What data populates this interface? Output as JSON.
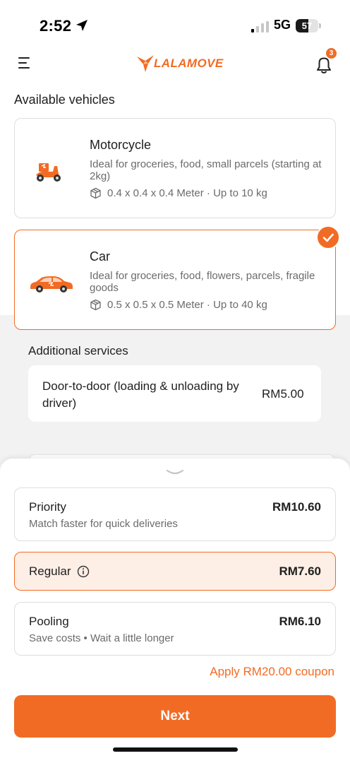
{
  "status_bar": {
    "time": "2:52",
    "network": "5G",
    "battery": "57",
    "battery_level": 0.57,
    "icons": [
      "location-arrow-icon",
      "signal-icon",
      "battery-icon"
    ]
  },
  "header": {
    "logo_text": "LALAMOVE",
    "notification_count": "3",
    "icons": [
      "menu-icon",
      "bell-icon"
    ]
  },
  "vehicles": {
    "title": "Available vehicles",
    "items": [
      {
        "name": "Motorcycle",
        "description": "Ideal for groceries, food, small parcels (starting at 2kg)",
        "dimensions": "0.4 x 0.4 x 0.4 Meter · Up to 10 kg",
        "selected": false
      },
      {
        "name": "Car",
        "description": "Ideal for groceries, food, flowers, parcels, fragile goods",
        "dimensions": "0.5 x 0.5 x 0.5 Meter · Up to 40 kg",
        "selected": true
      }
    ]
  },
  "additional_services": {
    "title": "Additional services",
    "items": [
      {
        "name": "Door-to-door (loading & unloading by driver)",
        "price": "RM5.00"
      }
    ]
  },
  "delivery_options": {
    "items": [
      {
        "name": "Priority",
        "subtitle": "Match faster for quick deliveries",
        "price": "RM10.60",
        "selected": false
      },
      {
        "name": "Regular",
        "subtitle": "",
        "price": "RM7.60",
        "selected": true
      },
      {
        "name": "Pooling",
        "subtitle": "Save costs • Wait a little longer",
        "price": "RM6.10",
        "selected": false
      }
    ],
    "coupon_link": "Apply RM20.00 coupon",
    "next_label": "Next"
  },
  "colors": {
    "brand": "#f26b24",
    "selected_bg": "#fdeee6",
    "section_bg": "#f2f2f2"
  }
}
